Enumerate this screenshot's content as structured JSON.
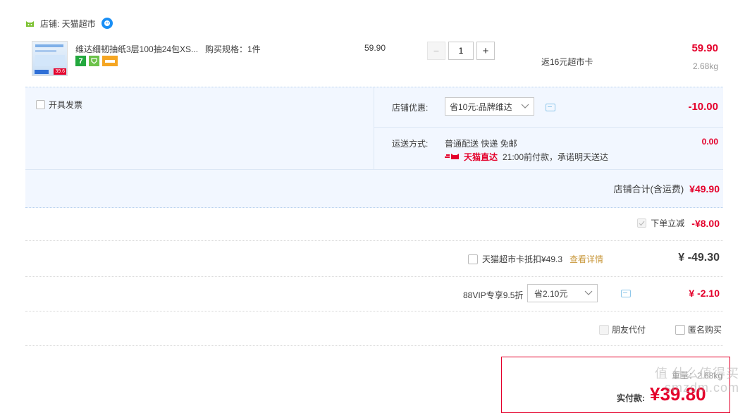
{
  "shop": {
    "label": "店铺: 天猫超市"
  },
  "item": {
    "title": "维达细韧抽纸3层100抽24包XS...",
    "spec": "购买规格：1件",
    "unit_price": "59.90",
    "quantity": "1",
    "minus": "−",
    "plus": "+",
    "cashback": "返16元超市卡",
    "subtotal": "59.90",
    "weight": "2.68kg",
    "thumb_price": "39.6"
  },
  "invoice": {
    "label": "开具发票"
  },
  "shop_discount": {
    "label": "店铺优惠:",
    "selected": "省10元:品牌维达",
    "amount": "-10.00"
  },
  "shipping": {
    "label": "运送方式:",
    "method": "普通配送 快递 免邮",
    "badge": "天猫直达",
    "promise": "21:00前付款，承诺明天送达",
    "amount": "0.00"
  },
  "shop_total": {
    "label": "店铺合计(含运费)",
    "amount": "¥49.90"
  },
  "instant_discount": {
    "label": "下单立减",
    "amount": "-¥8.00"
  },
  "market_card": {
    "label": "天猫超市卡抵扣¥49.3",
    "link": "查看详情",
    "amount": "¥ -49.30"
  },
  "vip": {
    "label": "88VIP专享9.5折",
    "selected": "省2.10元",
    "amount": "¥ -2.10"
  },
  "options": {
    "friend_pay": "朋友代付",
    "anonymous": "匿名购买"
  },
  "summary": {
    "pay_label": "实付款:",
    "pay_amount": "¥39.80",
    "weight": "重量：2.68kg"
  },
  "watermark": "值 什么值得买 smzdm.com",
  "colors": {
    "price_red": "#e4002b",
    "panel_bg": "#f2f7ff",
    "link_orange": "#c8973a"
  }
}
